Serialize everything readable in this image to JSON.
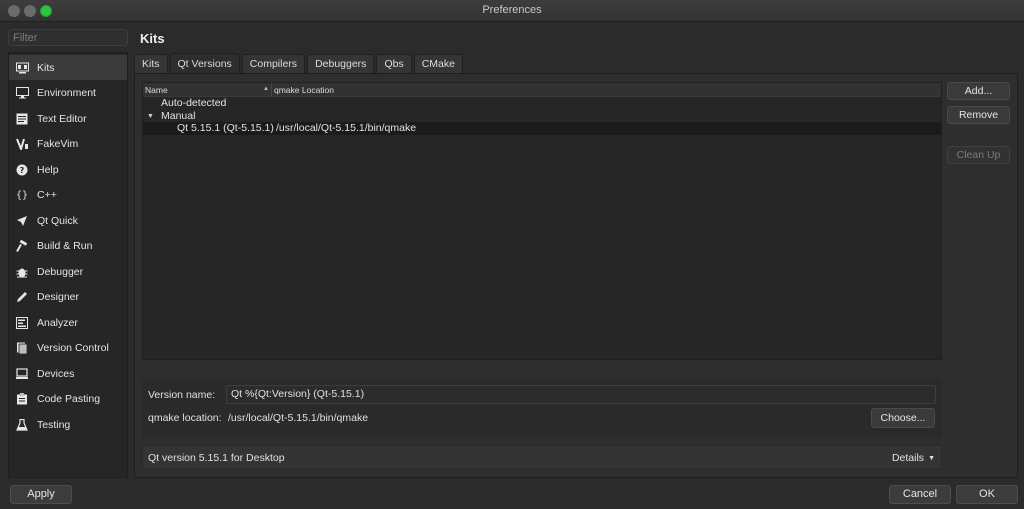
{
  "window": {
    "title": "Preferences"
  },
  "sidebar": {
    "filter_placeholder": "Filter",
    "items": [
      {
        "label": "Kits",
        "icon": "kits-icon",
        "active": true
      },
      {
        "label": "Environment",
        "icon": "monitor-icon"
      },
      {
        "label": "Text Editor",
        "icon": "text-editor-icon"
      },
      {
        "label": "FakeVim",
        "icon": "fakevim-icon"
      },
      {
        "label": "Help",
        "icon": "help-icon"
      },
      {
        "label": "C++",
        "icon": "braces-icon"
      },
      {
        "label": "Qt Quick",
        "icon": "paper-plane-icon"
      },
      {
        "label": "Build & Run",
        "icon": "hammer-icon"
      },
      {
        "label": "Debugger",
        "icon": "bug-icon"
      },
      {
        "label": "Designer",
        "icon": "pencil-icon"
      },
      {
        "label": "Analyzer",
        "icon": "analyzer-icon"
      },
      {
        "label": "Version Control",
        "icon": "version-control-icon"
      },
      {
        "label": "Devices",
        "icon": "devices-icon"
      },
      {
        "label": "Code Pasting",
        "icon": "clipboard-icon"
      },
      {
        "label": "Testing",
        "icon": "flask-icon"
      }
    ],
    "apply_label": "Apply"
  },
  "main": {
    "title": "Kits",
    "tabs": [
      {
        "label": "Kits"
      },
      {
        "label": "Qt Versions",
        "active": true
      },
      {
        "label": "Compilers"
      },
      {
        "label": "Debuggers"
      },
      {
        "label": "Qbs"
      },
      {
        "label": "CMake"
      }
    ],
    "tree": {
      "columns": [
        "Name",
        "qmake Location"
      ],
      "rows": [
        {
          "name": "Auto-detected",
          "location": ""
        },
        {
          "name": "Manual",
          "location": ""
        },
        {
          "name": "Qt 5.15.1 (Qt-5.15.1)",
          "location": "/usr/local/Qt-5.15.1/bin/qmake",
          "selected": true
        }
      ]
    },
    "buttons": {
      "add": "Add...",
      "remove": "Remove",
      "cleanup": "Clean Up"
    },
    "details": {
      "version_name_label": "Version name:",
      "version_name_value": "Qt %{Qt:Version} (Qt-5.15.1)",
      "qmake_label": "qmake location:",
      "qmake_value": "/usr/local/Qt-5.15.1/bin/qmake",
      "choose_label": "Choose...",
      "summary": "Qt version 5.15.1 for Desktop",
      "details_toggle": "Details"
    }
  },
  "footer": {
    "cancel": "Cancel",
    "ok": "OK"
  }
}
